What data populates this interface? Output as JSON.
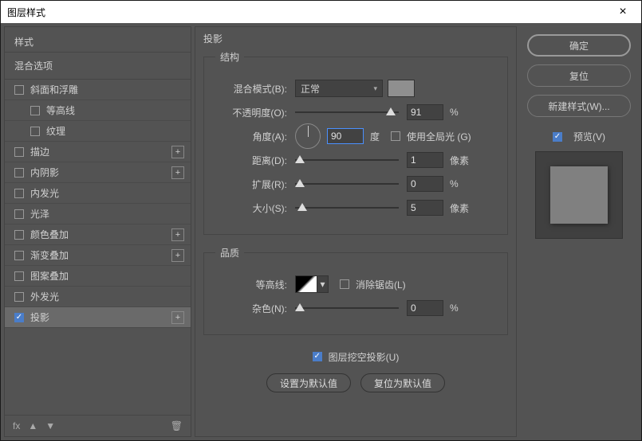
{
  "window": {
    "title": "图层样式"
  },
  "left": {
    "styles_label": "样式",
    "blend_label": "混合选项",
    "items": [
      {
        "label": "斜面和浮雕",
        "checked": false,
        "plus": false
      },
      {
        "label": "等高线",
        "checked": false,
        "indent": true,
        "plus": false
      },
      {
        "label": "纹理",
        "checked": false,
        "indent": true,
        "plus": false
      },
      {
        "label": "描边",
        "checked": false,
        "plus": true
      },
      {
        "label": "内阴影",
        "checked": false,
        "plus": true
      },
      {
        "label": "内发光",
        "checked": false,
        "plus": false
      },
      {
        "label": "光泽",
        "checked": false,
        "plus": false
      },
      {
        "label": "颜色叠加",
        "checked": false,
        "plus": true
      },
      {
        "label": "渐变叠加",
        "checked": false,
        "plus": true
      },
      {
        "label": "图案叠加",
        "checked": false,
        "plus": false
      },
      {
        "label": "外发光",
        "checked": false,
        "plus": false
      },
      {
        "label": "投影",
        "checked": true,
        "plus": true,
        "active": true
      }
    ],
    "fx": "fx"
  },
  "center": {
    "title": "投影",
    "structure": {
      "legend": "结构",
      "blend_label": "混合模式(B):",
      "blend_value": "正常",
      "opacity_label": "不透明度(O):",
      "opacity_value": "91",
      "opacity_unit": "%",
      "angle_label": "角度(A):",
      "angle_value": "90",
      "angle_unit": "度",
      "global_label": "使用全局光 (G)",
      "distance_label": "距离(D):",
      "distance_value": "1",
      "distance_unit": "像素",
      "spread_label": "扩展(R):",
      "spread_value": "0",
      "spread_unit": "%",
      "size_label": "大小(S):",
      "size_value": "5",
      "size_unit": "像素"
    },
    "quality": {
      "legend": "品质",
      "contour_label": "等高线:",
      "antialias_label": "消除锯齿(L)",
      "noise_label": "杂色(N):",
      "noise_value": "0",
      "noise_unit": "%"
    },
    "knockout_label": "图层挖空投影(U)",
    "set_default": "设置为默认值",
    "reset_default": "复位为默认值"
  },
  "right": {
    "ok": "确定",
    "cancel": "复位",
    "new_style": "新建样式(W)...",
    "preview": "预览(V)"
  }
}
